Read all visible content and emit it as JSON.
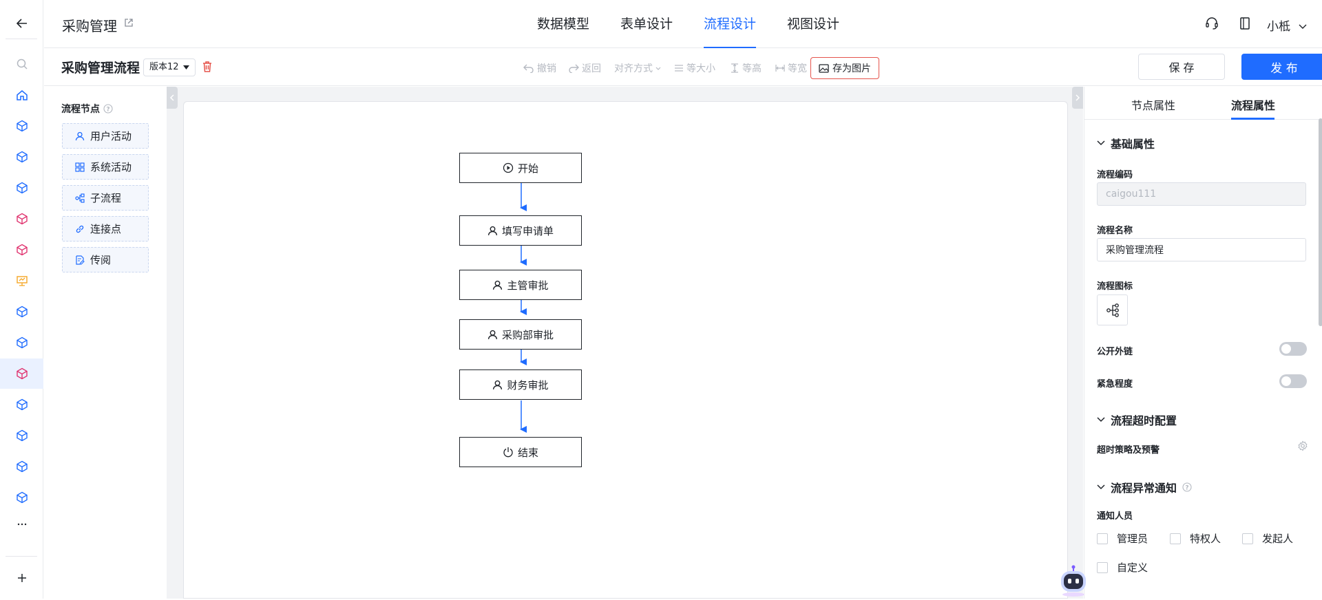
{
  "header": {
    "app_title": "采购管理",
    "tabs": [
      "数据模型",
      "表单设计",
      "流程设计",
      "视图设计"
    ],
    "active_tab": "流程设计",
    "user_name": "小柢"
  },
  "toolbar": {
    "flow_name": "采购管理流程",
    "version": "版本12",
    "undo": "撤销",
    "redo": "返回",
    "align": "对齐方式",
    "same_size": "等大小",
    "same_height": "等高",
    "same_width": "等宽",
    "save_image": "存为图片",
    "save": "保 存",
    "publish": "发 布"
  },
  "palette": {
    "title": "流程节点",
    "items": [
      {
        "label": "用户活动",
        "icon": "user-icon"
      },
      {
        "label": "系统活动",
        "icon": "grid-icon"
      },
      {
        "label": "子流程",
        "icon": "subflow-icon"
      },
      {
        "label": "连接点",
        "icon": "link-icon"
      },
      {
        "label": "传阅",
        "icon": "document-edit-icon"
      }
    ]
  },
  "flow": {
    "nodes": [
      {
        "label": "开始",
        "icon": "play-circle-icon"
      },
      {
        "label": "填写申请单",
        "icon": "user-icon"
      },
      {
        "label": "主管审批",
        "icon": "user-icon"
      },
      {
        "label": "采购部审批",
        "icon": "user-icon"
      },
      {
        "label": "财务审批",
        "icon": "user-icon"
      },
      {
        "label": "结束",
        "icon": "power-icon"
      }
    ]
  },
  "props": {
    "tabs": [
      "节点属性",
      "流程属性"
    ],
    "active_tab": "流程属性",
    "basic_section": "基础属性",
    "code_label": "流程编码",
    "code_value": "caigou111",
    "name_label": "流程名称",
    "name_value": "采购管理流程",
    "icon_label": "流程图标",
    "public_link_label": "公开外链",
    "public_link_on": false,
    "urgency_label": "紧急程度",
    "urgency_on": false,
    "timeout_section": "流程超时配置",
    "timeout_policy_label": "超时策略及预警",
    "exception_section": "流程异常通知",
    "notify_label": "通知人员",
    "notify_options": [
      "管理员",
      "特权人",
      "发起人",
      "自定义"
    ]
  },
  "colors": {
    "accent": "#1f6cff",
    "danger": "#e5534b"
  }
}
